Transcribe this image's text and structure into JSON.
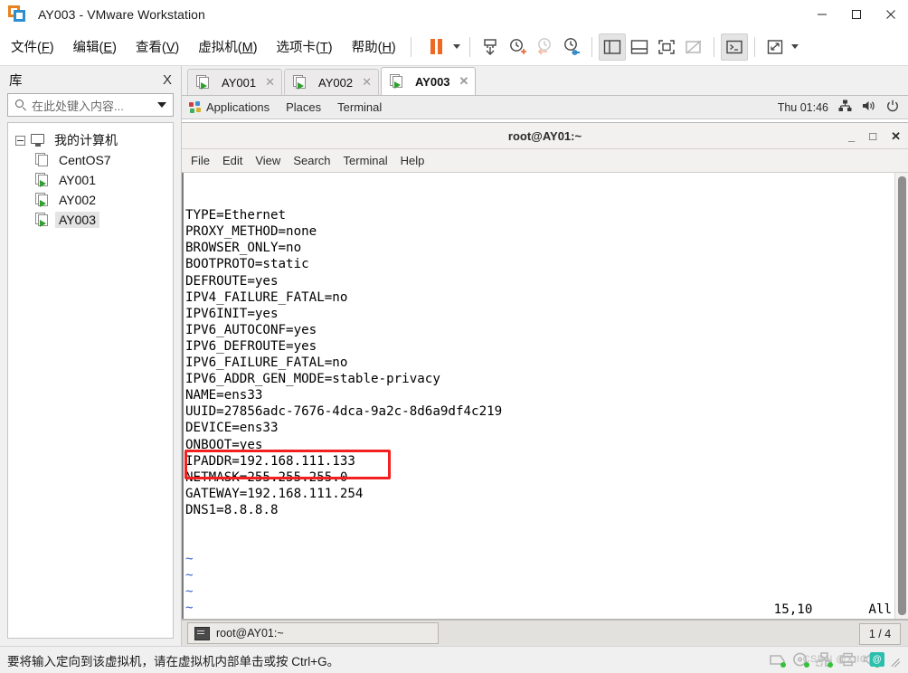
{
  "window": {
    "title": "AY003 - VMware Workstation",
    "logo_icon": "vmware-logo-icon",
    "minimize_icon": "minimize-icon",
    "maximize_icon": "maximize-icon",
    "close_icon": "close-icon"
  },
  "menubar": {
    "items": [
      {
        "label": "文件",
        "accel": "F"
      },
      {
        "label": "编辑",
        "accel": "E"
      },
      {
        "label": "查看",
        "accel": "V"
      },
      {
        "label": "虚拟机",
        "accel": "M"
      },
      {
        "label": "选项卡",
        "accel": "T"
      },
      {
        "label": "帮助",
        "accel": "H"
      }
    ]
  },
  "toolbar": {
    "buttons": [
      {
        "name": "suspend-icon"
      },
      {
        "name": "suspend-dropdown-caret-icon"
      },
      {
        "name": "power-snapshot-icon"
      },
      {
        "name": "take-snapshot-icon"
      },
      {
        "name": "revert-snapshot-icon"
      },
      {
        "name": "snapshot-manager-icon"
      },
      {
        "name": "show-library-icon"
      },
      {
        "name": "show-thumbnail-bar-icon"
      },
      {
        "name": "full-screen-icon"
      },
      {
        "name": "unity-mode-icon"
      },
      {
        "name": "console-view-icon"
      },
      {
        "name": "stretch-view-icon"
      },
      {
        "name": "stretch-dropdown-caret-icon"
      }
    ]
  },
  "sidebar": {
    "title": "库",
    "close_label": "X",
    "search": {
      "placeholder": "在此处键入内容...",
      "value": "",
      "icon": "search-icon",
      "dropdown_icon": "chevron-down-icon"
    },
    "tree": {
      "root": {
        "label": "我的计算机",
        "icon": "my-computer-icon",
        "expander": "collapse-icon"
      },
      "items": [
        {
          "label": "CentOS7",
          "icon": "vm-powered-off-icon",
          "running": false,
          "selected": false
        },
        {
          "label": "AY001",
          "icon": "vm-running-icon",
          "running": true,
          "selected": false
        },
        {
          "label": "AY002",
          "icon": "vm-running-icon",
          "running": true,
          "selected": false
        },
        {
          "label": "AY003",
          "icon": "vm-running-icon",
          "running": true,
          "selected": true
        }
      ]
    }
  },
  "tabs": [
    {
      "label": "AY001",
      "active": false,
      "close_label": "✕",
      "icon": "vm-running-icon"
    },
    {
      "label": "AY002",
      "active": false,
      "close_label": "✕",
      "icon": "vm-running-icon"
    },
    {
      "label": "AY003",
      "active": true,
      "close_label": "✕",
      "icon": "vm-running-icon"
    }
  ],
  "guest": {
    "panel": {
      "applications": "Applications",
      "places": "Places",
      "terminal": "Terminal",
      "clock": "Thu 01:46",
      "network_icon": "network-icon",
      "volume_icon": "volume-icon",
      "power_icon": "power-icon",
      "foot_icon": "gnome-foot-icon"
    },
    "terminal": {
      "title": "root@AY01:~",
      "minimize_label": "_",
      "maximize_label": "□",
      "close_label": "✕",
      "menu": [
        "File",
        "Edit",
        "View",
        "Search",
        "Terminal",
        "Help"
      ],
      "content_lines": [
        "TYPE=Ethernet",
        "PROXY_METHOD=none",
        "BROWSER_ONLY=no",
        "BOOTPROTO=static",
        "DEFROUTE=yes",
        "IPV4_FAILURE_FATAL=no",
        "IPV6INIT=yes",
        "IPV6_AUTOCONF=yes",
        "IPV6_DEFROUTE=yes",
        "IPV6_FAILURE_FATAL=no",
        "IPV6_ADDR_GEN_MODE=stable-privacy",
        "NAME=ens33",
        "UUID=27856adc-7676-4dca-9a2c-8d6a9df4c219",
        "DEVICE=ens33",
        "ONBOOT=yes",
        "IPADDR=192.168.111.133",
        "NETMASK=255.255.255.0",
        "GATEWAY=192.168.111.254",
        "DNS1=8.8.8.8"
      ],
      "empty_markers": [
        "~",
        "~",
        "~",
        "~",
        "~",
        "~",
        "~"
      ],
      "cursor_position": "15,10",
      "scroll_position": "All",
      "highlight_line": "IPADDR=192.168.111.133",
      "highlight_color": "#f41f1f"
    },
    "taskbar": {
      "window_button": "root@AY01:~",
      "window_icon": "terminal-icon",
      "workspace": "1 / 4"
    }
  },
  "statusbar": {
    "message": "要将输入定向到该虚拟机，请在虚拟机内部单击或按 Ctrl+G。",
    "devices": [
      {
        "name": "hard-disk-icon"
      },
      {
        "name": "cd-dvd-icon"
      },
      {
        "name": "network-adapter-icon"
      },
      {
        "name": "printer-icon"
      },
      {
        "name": "sound-card-icon"
      }
    ],
    "watermark": "CSDN @X.IO",
    "grip_icon": "resize-grip-icon"
  }
}
